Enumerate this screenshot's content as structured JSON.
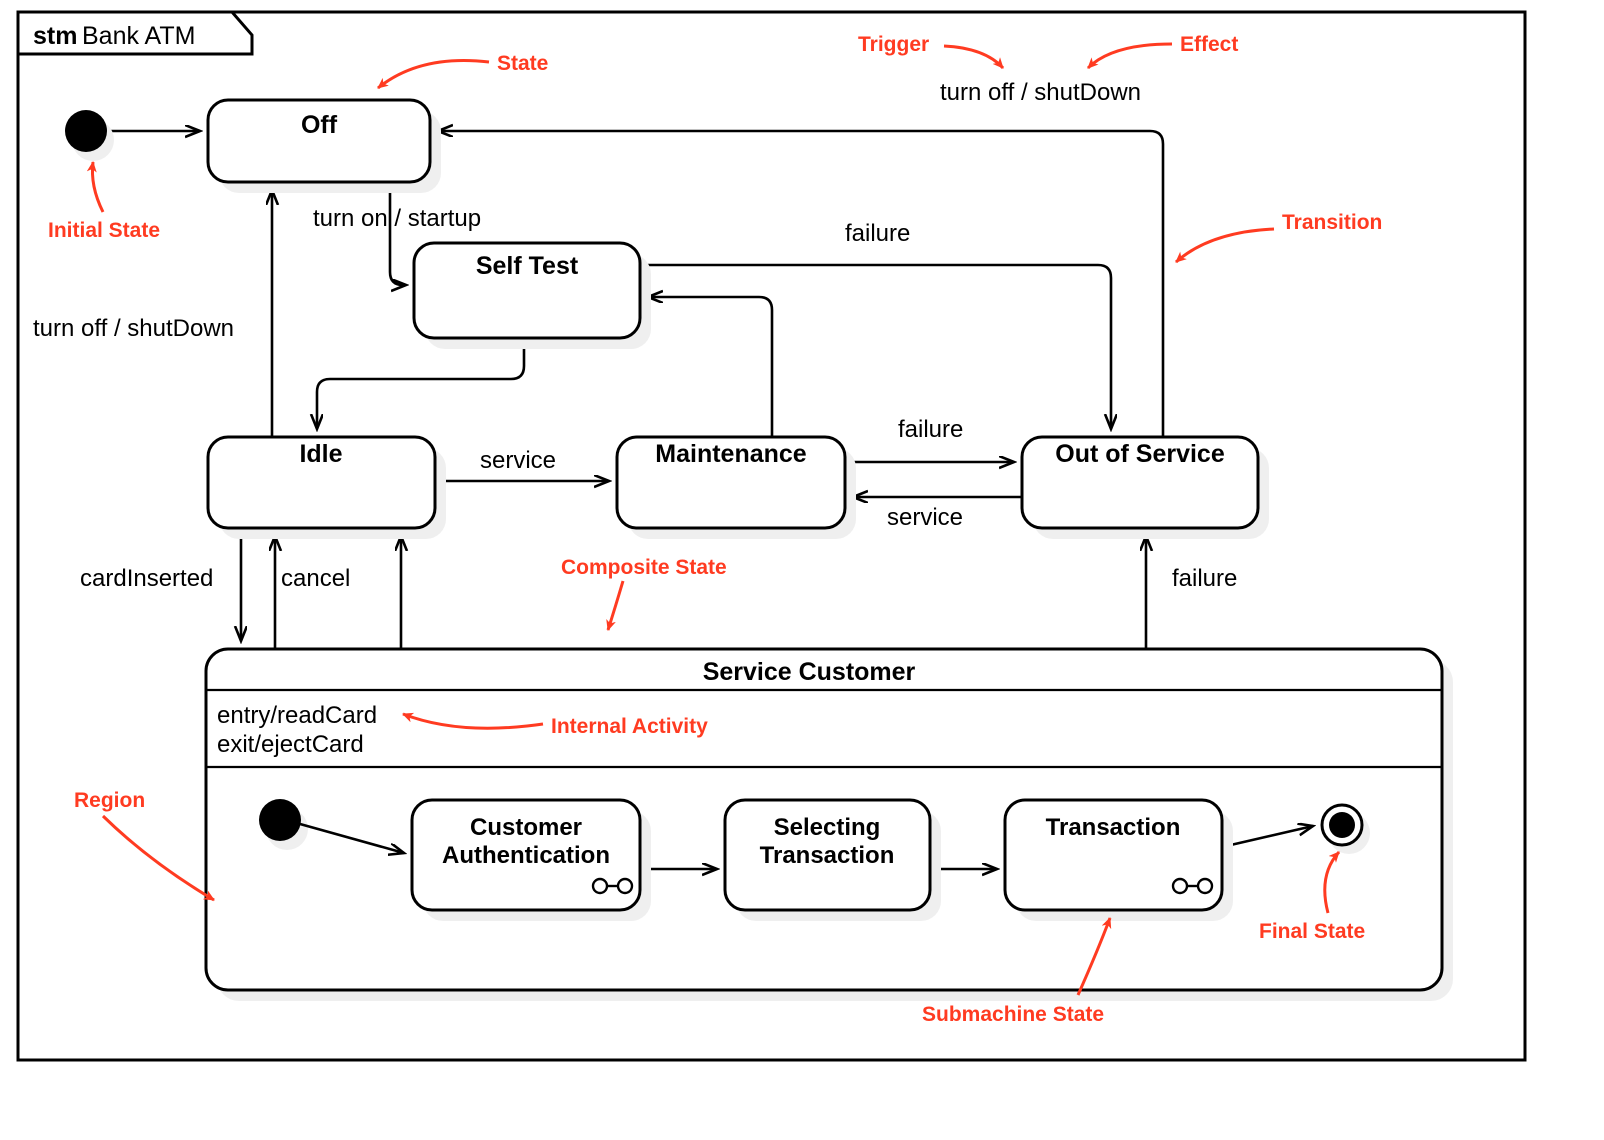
{
  "frame": {
    "kind": "stm",
    "name": "Bank ATM"
  },
  "states": {
    "off": "Off",
    "self_test": "Self Test",
    "idle": "Idle",
    "maintenance": "Maintenance",
    "out_of_service": "Out of Service",
    "service_customer": "Service Customer"
  },
  "composite": {
    "title": "Service Customer",
    "activities": {
      "entry": "entry/readCard",
      "exit": "exit/ejectCard"
    },
    "substates": {
      "customer_authentication_line1": "Customer",
      "customer_authentication_line2": "Authentication",
      "selecting_transaction_line1": "Selecting",
      "selecting_transaction_line2": "Transaction",
      "transaction": "Transaction"
    }
  },
  "transitions": {
    "turn_on_startup": "turn on / startup",
    "turn_off_shutdown_left": "turn off / shutDown",
    "turn_off_shutdown_top": "turn off / shutDown",
    "failure_selftest": "failure",
    "failure_maint_to_oos": "failure",
    "service_oos_to_maint": "service",
    "service_idle_to_maint": "service",
    "card_inserted": "cardInserted",
    "cancel": "cancel",
    "failure_service_to_oos": "failure"
  },
  "annotations": {
    "state": "State",
    "trigger": "Trigger",
    "effect": "Effect",
    "initial_state": "Initial State",
    "transition": "Transition",
    "composite_state": "Composite State",
    "internal_activity": "Internal Activity",
    "region": "Region",
    "final_state": "Final State",
    "submachine_state": "Submachine State"
  },
  "colors": {
    "annotation": "#ff3b21",
    "stroke": "#000000",
    "shadow": "#efefef",
    "background": "#ffffff"
  },
  "icons": {
    "initial_state": "filled-circle-icon",
    "final_state": "bullseye-circle-icon",
    "submachine": "submachine-indicator-icon"
  }
}
